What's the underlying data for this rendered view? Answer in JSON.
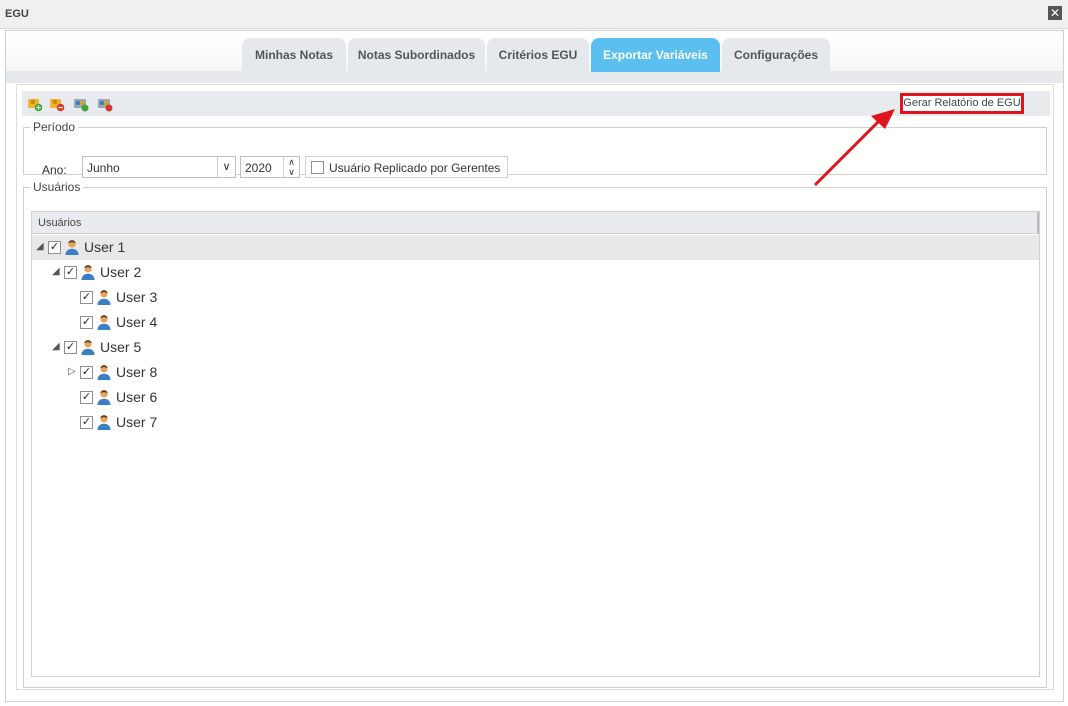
{
  "window": {
    "title": "EGU",
    "close_symbol": "✕"
  },
  "tabs": [
    {
      "label": "Minhas Notas",
      "active": false
    },
    {
      "label": "Notas Subordinados",
      "active": false
    },
    {
      "label": "Critérios EGU",
      "active": false
    },
    {
      "label": "Exportar Variáveis",
      "active": true
    },
    {
      "label": "Configurações",
      "active": false
    }
  ],
  "toolbar": {
    "icons": [
      "add-user-icon",
      "remove-user-icon",
      "import-users-icon",
      "delete-users-icon"
    ],
    "generate_report_label": "Gerar Relatório de EGU"
  },
  "period": {
    "legend": "Período",
    "ano_label": "Ano:",
    "month_value": "Junho",
    "year_value": "2020",
    "replicated_label": "Usuário Replicado por Gerentes",
    "replicated_checked": false
  },
  "users": {
    "legend": "Usuários",
    "column_header": "Usuários",
    "rows": [
      {
        "label": "User 1",
        "level": 0,
        "expander": "◢",
        "checked": true
      },
      {
        "label": "User 2",
        "level": 1,
        "expander": "◢",
        "checked": true
      },
      {
        "label": "User 3",
        "level": 2,
        "expander": "",
        "checked": true
      },
      {
        "label": "User 4",
        "level": 2,
        "expander": "",
        "checked": true
      },
      {
        "label": "User 5",
        "level": 1,
        "expander": "◢",
        "checked": true
      },
      {
        "label": "User 8",
        "level": 2,
        "expander": "▷",
        "checked": true
      },
      {
        "label": "User 6",
        "level": 2,
        "expander": "",
        "checked": true
      },
      {
        "label": "User 7",
        "level": 2,
        "expander": "",
        "checked": true
      }
    ]
  },
  "colors": {
    "active_tab": "#5bc0f0",
    "annotation": "#e0151c"
  }
}
